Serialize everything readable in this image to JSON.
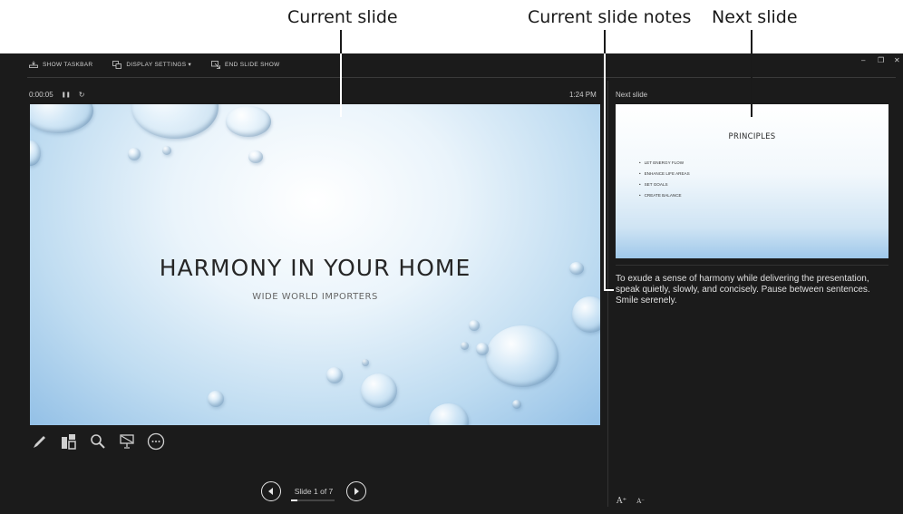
{
  "callouts": {
    "current_slide": "Current slide",
    "current_slide_notes": "Current slide notes",
    "next_slide": "Next slide"
  },
  "toolbar": {
    "show_taskbar": "SHOW TASKBAR",
    "display_settings": "DISPLAY SETTINGS ▾",
    "end_slide_show": "END SLIDE SHOW"
  },
  "window_controls": {
    "minimize": "–",
    "restore": "❐",
    "close": "✕"
  },
  "timer": {
    "elapsed": "0:00:05",
    "pause_icon": "❚❚",
    "restart_icon": "↻"
  },
  "clock": "1:24 PM",
  "next_label": "Next slide",
  "current_slide": {
    "title": "HARMONY IN YOUR HOME",
    "subtitle": "WIDE WORLD IMPORTERS"
  },
  "next_slide": {
    "title": "PRINCIPLES",
    "bullets": [
      "LET ENERGY FLOW",
      "ENHANCE LIFE AREAS",
      "SET GOALS",
      "CREATE BALANCE"
    ]
  },
  "notes": "To exude a sense of harmony while delivering the presentation, speak quietly, slowly, and concisely. Pause between sentences. Smile serenely.",
  "navigation": {
    "counter": "Slide 1 of 7",
    "progress": 0.14
  },
  "font_controls": {
    "increase": "A⁺",
    "decrease": "A⁻"
  },
  "colors": {
    "window_bg": "#1b1b1b",
    "text_light": "#e0e0e0"
  }
}
